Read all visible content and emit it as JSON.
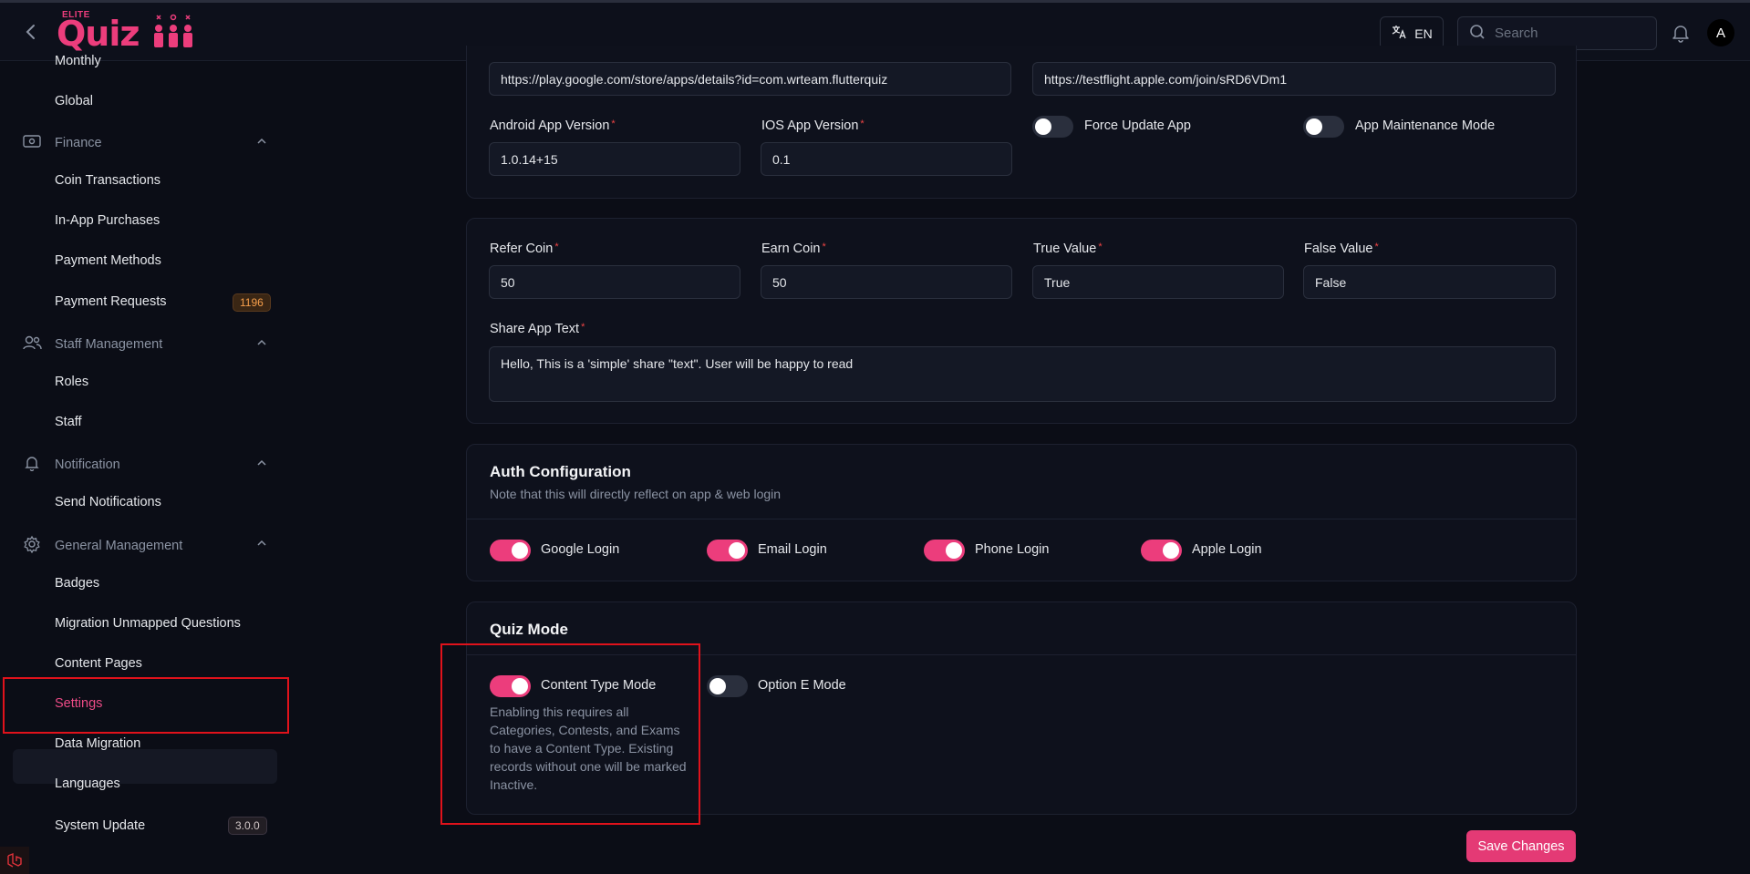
{
  "header": {
    "logo_small": "ELITE",
    "logo_text": "Quiz",
    "lang": "EN",
    "search_placeholder": "Search",
    "avatar_letter": "A"
  },
  "sidebar": {
    "monthly": "Monthly",
    "global": "Global",
    "finance": "Finance",
    "coin_transactions": "Coin Transactions",
    "in_app_purchases": "In-App Purchases",
    "payment_methods": "Payment Methods",
    "payment_requests": "Payment Requests",
    "payment_requests_badge": "1196",
    "staff_management": "Staff Management",
    "roles": "Roles",
    "staff": "Staff",
    "notification": "Notification",
    "send_notifications": "Send Notifications",
    "general_management": "General Management",
    "badges": "Badges",
    "migration_unmapped": "Migration Unmapped Questions",
    "content_pages": "Content Pages",
    "settings": "Settings",
    "data_migration": "Data Migration",
    "languages": "Languages",
    "system_update": "System Update",
    "system_update_badge": "3.0.0"
  },
  "app_card": {
    "android_url": "https://play.google.com/store/apps/details?id=com.wrteam.flutterquiz",
    "ios_url": "https://testflight.apple.com/join/sRD6VDm1",
    "android_version_label": "Android App Version",
    "android_version": "1.0.14+15",
    "ios_version_label": "IOS App Version",
    "ios_version": "0.1",
    "force_update_label": "Force Update App",
    "maintenance_label": "App Maintenance Mode"
  },
  "coin_card": {
    "refer_coin_label": "Refer Coin",
    "refer_coin": "50",
    "earn_coin_label": "Earn Coin",
    "earn_coin": "50",
    "true_value_label": "True Value",
    "true_value": "True",
    "false_value_label": "False Value",
    "false_value": "False",
    "share_text_label": "Share App Text",
    "share_text": "Hello, This is a 'simple' share \"text\". User will be happy to read"
  },
  "auth_card": {
    "title": "Auth Configuration",
    "subtitle": "Note that this will directly reflect on app & web login",
    "google": "Google Login",
    "email": "Email Login",
    "phone": "Phone Login",
    "apple": "Apple Login"
  },
  "quiz_card": {
    "title": "Quiz Mode",
    "content_type": "Content Type Mode",
    "content_type_help": "Enabling this requires all Categories, Contests, and Exams to have a Content Type. Existing records without one will be marked Inactive.",
    "option_e": "Option E Mode"
  },
  "save_label": "Save Changes",
  "colors": {
    "accent": "#ec3d7c",
    "background": "#0b0d16",
    "card": "#0e111c"
  }
}
